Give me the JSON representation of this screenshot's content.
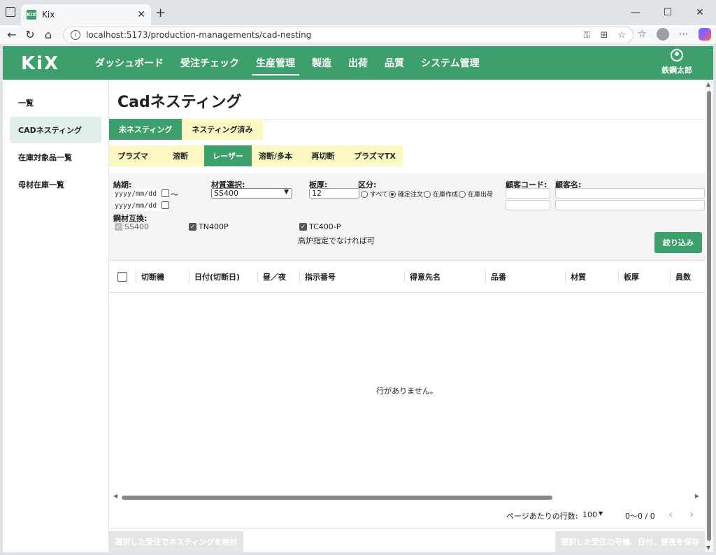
{
  "browser": {
    "tab_title": "Kix",
    "favicon_text": "KiX",
    "url": "localhost:5173/production-managements/cad-nesting",
    "icons": [
      "tab-actions-icon",
      "close-tab-icon",
      "new-tab-icon",
      "back-icon",
      "refresh-icon",
      "home-icon",
      "info-icon",
      "key-icon",
      "reader-icon",
      "favorite-icon",
      "collections-icon",
      "more-icon",
      "copilot-icon",
      "minimize-icon",
      "maximize-icon",
      "close-window-icon"
    ]
  },
  "app": {
    "logo": "KiX",
    "menu": [
      "ダッシュボード",
      "受注チェック",
      "生産管理",
      "製造",
      "出荷",
      "品質",
      "システム管理"
    ],
    "active_menu": "生産管理",
    "user_name": "鉄鋼太郎",
    "brand_color": "#3d9f6c"
  },
  "sidebar": {
    "items": [
      "一覧",
      "CADネスティング",
      "在庫対象品一覧",
      "母材在庫一覧"
    ],
    "active": "CADネスティング"
  },
  "page": {
    "title": "Cadネスティング",
    "status_tabs": [
      "未ネスティング",
      "ネスティング済み"
    ],
    "active_status_tab": "未ネスティング",
    "method_tabs": [
      "プラズマ",
      "溶断",
      "レーザー",
      "溶断/多本",
      "再切断",
      "プラズマTX"
    ],
    "active_method_tab": "レーザー"
  },
  "filters": {
    "delivery_label": "納期:",
    "date_from_placeholder": "yyyy/mm/dd",
    "date_to_placeholder": "yyyy/mm/dd",
    "tilde": "〜",
    "material_label": "材質選択:",
    "material_value": "SS400",
    "thickness_label": "板厚:",
    "thickness_value": "12",
    "category_label": "区分:",
    "category_options": [
      "すべて",
      "確定注文",
      "在庫作成",
      "在庫出荷"
    ],
    "category_selected": "確定注文",
    "customer_code_label": "顧客コード:",
    "customer_name_label": "顧客名:",
    "compat_label": "鋼材互換:",
    "compat_items": [
      {
        "label": "SS400",
        "checked": true,
        "disabled": true
      },
      {
        "label": "TN400P",
        "checked": true,
        "disabled": false
      },
      {
        "label": "TC400-P",
        "checked": true,
        "disabled": false
      }
    ],
    "compat_note": "高炉指定でなければ可",
    "filter_button": "絞り込み"
  },
  "grid": {
    "columns": [
      "切断機",
      "日付(切断日)",
      "昼／夜",
      "指示番号",
      "得意先名",
      "品番",
      "材質",
      "板厚",
      "員数"
    ],
    "empty_message": "行がありません。",
    "rows_per_page_label": "ページあたりの行数:",
    "rows_per_page_value": "100",
    "range_text": "0〜0 / 0"
  },
  "actions": {
    "review_nesting": "選択した受注でネスティングを検討",
    "save_selection": "選択した受注の号機、日付、昼夜を保存"
  }
}
